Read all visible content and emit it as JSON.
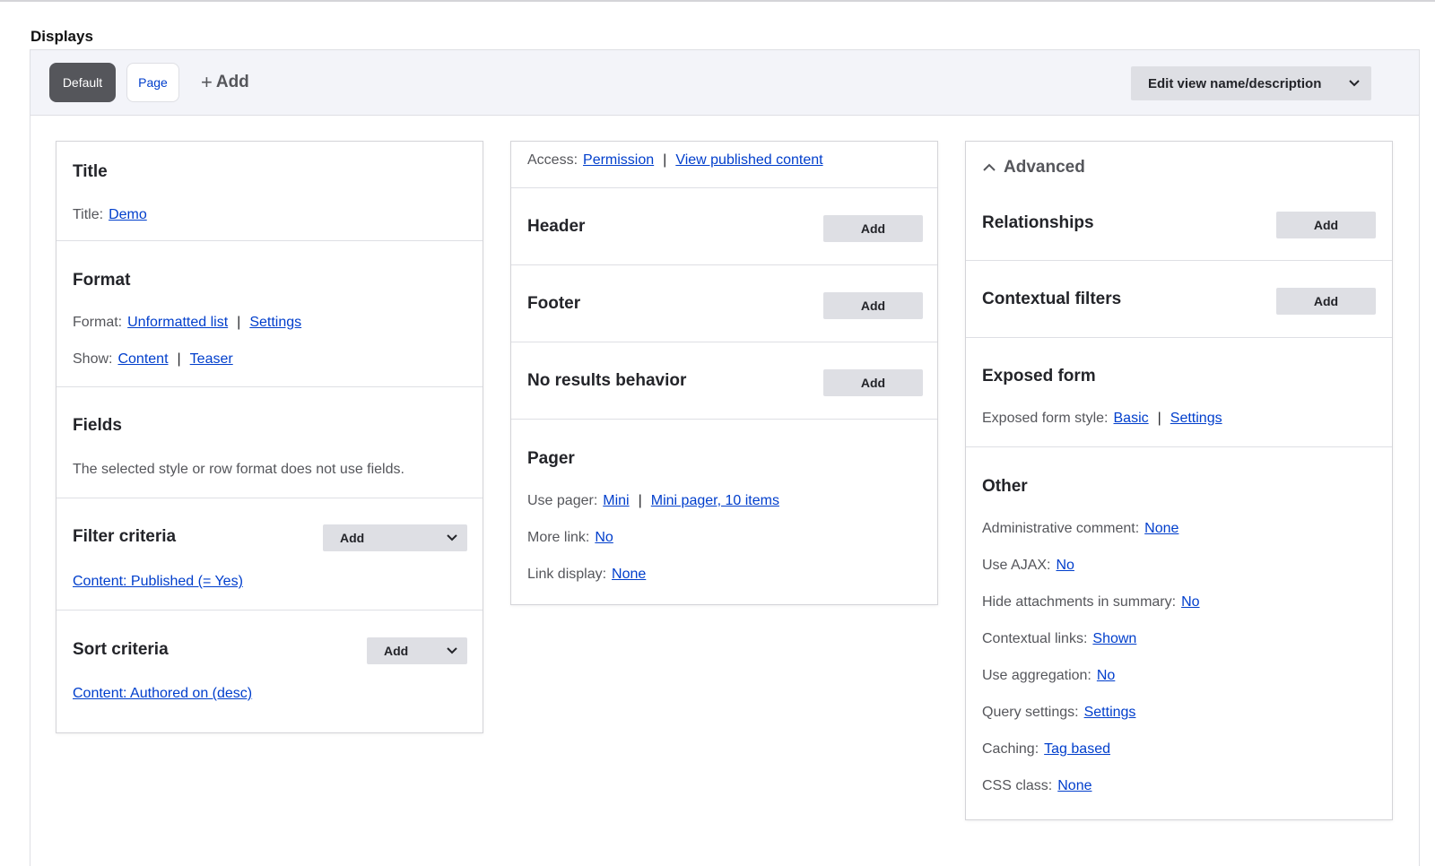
{
  "displays_label": "Displays",
  "tabs": {
    "default": "Default",
    "page": "Page",
    "add_plus": "+",
    "add": "Add"
  },
  "edit_button": "Edit view name/description",
  "col1": {
    "title": {
      "heading": "Title",
      "label": "Title:",
      "value": "Demo"
    },
    "format": {
      "heading": "Format",
      "format_label": "Format:",
      "format_value": "Unformatted list",
      "format_settings": "Settings",
      "show_label": "Show:",
      "show_value": "Content",
      "show_mode": "Teaser"
    },
    "fields": {
      "heading": "Fields",
      "note": "The selected style or row format does not use fields."
    },
    "filter": {
      "heading": "Filter criteria",
      "add": "Add",
      "item": "Content: Published (= Yes)"
    },
    "sort": {
      "heading": "Sort criteria",
      "add": "Add",
      "item": "Content: Authored on (desc)"
    }
  },
  "col2": {
    "access": {
      "label": "Access:",
      "value": "Permission",
      "detail": "View published content"
    },
    "header": {
      "heading": "Header",
      "add": "Add"
    },
    "footer": {
      "heading": "Footer",
      "add": "Add"
    },
    "no_results": {
      "heading": "No results behavior",
      "add": "Add"
    },
    "pager": {
      "heading": "Pager",
      "use_pager_label": "Use pager:",
      "use_pager_value": "Mini",
      "use_pager_detail": "Mini pager, 10 items",
      "more_link_label": "More link:",
      "more_link_value": "No",
      "link_display_label": "Link display:",
      "link_display_value": "None"
    }
  },
  "col3": {
    "advanced": "Advanced",
    "relationships": {
      "heading": "Relationships",
      "add": "Add"
    },
    "contextual": {
      "heading": "Contextual filters",
      "add": "Add"
    },
    "exposed": {
      "heading": "Exposed form",
      "label": "Exposed form style:",
      "value": "Basic",
      "settings": "Settings"
    },
    "other": {
      "heading": "Other",
      "rows": [
        {
          "label": "Administrative comment:",
          "value": "None"
        },
        {
          "label": "Use AJAX:",
          "value": "No"
        },
        {
          "label": "Hide attachments in summary:",
          "value": "No"
        },
        {
          "label": "Contextual links:",
          "value": "Shown"
        },
        {
          "label": "Use aggregation:",
          "value": "No"
        },
        {
          "label": "Query settings:",
          "value": "Settings"
        },
        {
          "label": "Caching:",
          "value": "Tag based"
        },
        {
          "label": "CSS class:",
          "value": "None"
        }
      ]
    }
  },
  "separator": "|"
}
